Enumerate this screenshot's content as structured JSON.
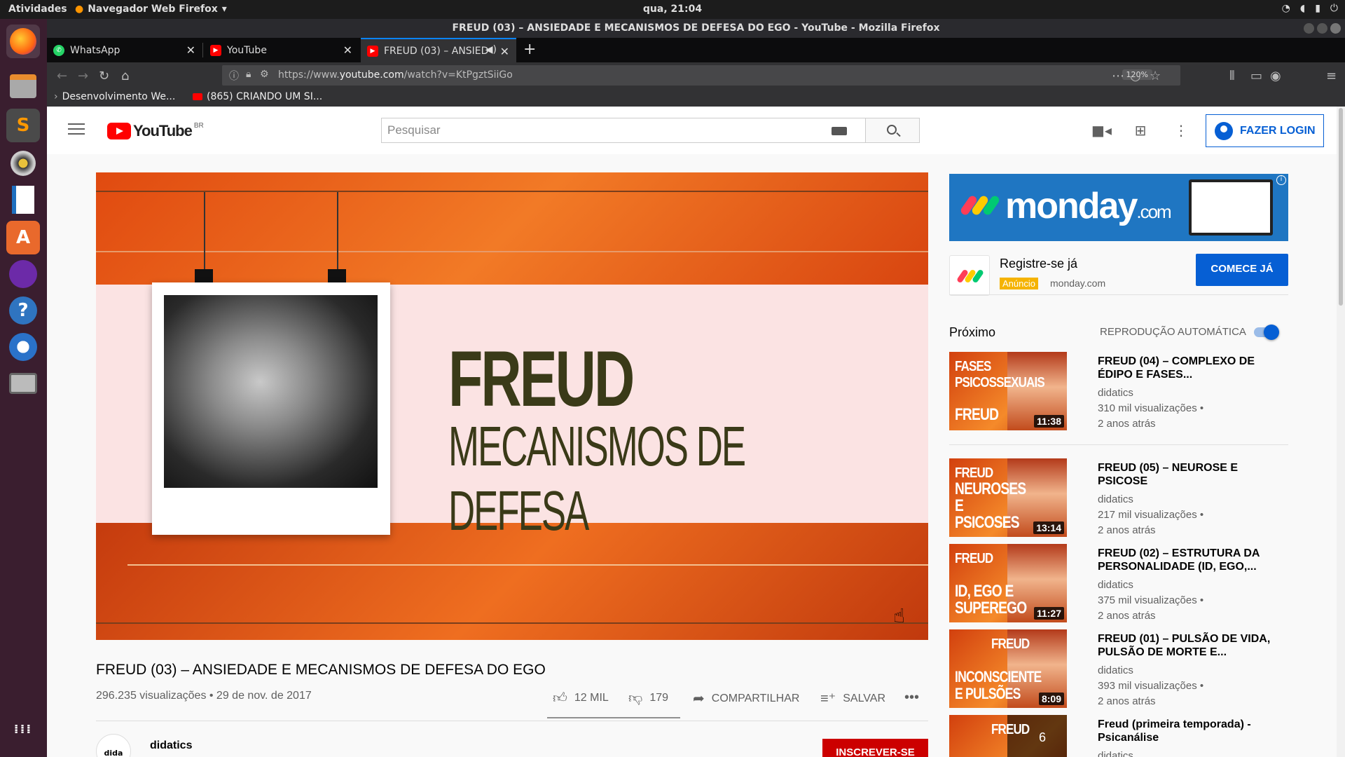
{
  "system": {
    "activities": "Atividades",
    "app_menu": "Navegador Web Firefox",
    "clock": "qua, 21:04"
  },
  "window": {
    "title": "FREUD (03) – ANSIEDADE E MECANISMOS DE DEFESA DO EGO - YouTube - Mozilla Firefox"
  },
  "tabs": [
    {
      "label": "WhatsApp",
      "color": "#25d366"
    },
    {
      "label": "YouTube",
      "color": "#ff0000"
    },
    {
      "label": "FREUD (03) – ANSIED",
      "color": "#ff0000"
    }
  ],
  "navbar": {
    "url_prefix": "https://www.",
    "url_domain": "youtube.com",
    "url_path": "/watch?v=KtPgztSiiGo",
    "zoom": "120%"
  },
  "bookmarks": [
    {
      "label": "Desenvolvimento We..."
    },
    {
      "label": "(865) CRIANDO UM SI..."
    }
  ],
  "header": {
    "logo_text": "YouTube",
    "region": "BR",
    "search_placeholder": "Pesquisar",
    "login_label": "FAZER LOGIN"
  },
  "video": {
    "thumb_title": "FREUD",
    "thumb_subtitle": "MECANISMOS DE DEFESA",
    "title": "FREUD (03) – ANSIEDADE E MECANISMOS DE DEFESA DO EGO",
    "meta": "296.235 visualizações • 29 de nov. de 2017",
    "likes": "12 MIL",
    "dislikes": "179",
    "share_label": "COMPARTILHAR",
    "save_label": "SALVAR",
    "channel": "didatics",
    "channel_avatar_text": "dida",
    "subscribe_label": "INSCREVER-SE"
  },
  "ad": {
    "banner_brand": "monday",
    "banner_suffix": ".com",
    "title": "Registre-se já",
    "badge": "Anúncio",
    "domain": "monday.com",
    "cta": "COMECE JÁ",
    "colors": [
      "#ff3d57",
      "#ffcb00",
      "#00ca72"
    ]
  },
  "sidebar": {
    "next_label": "Próximo",
    "autoplay_label": "REPRODUÇÃO AUTOMÁTICA",
    "autoplay_on": true,
    "recommendations": [
      {
        "thumb_top": "FASES PSICOSSEXUAIS",
        "thumb_bottom": "FREUD",
        "duration": "11:38",
        "title": "FREUD (04) – COMPLEXO DE ÉDIPO E FASES...",
        "channel": "didatics",
        "views": "310 mil visualizações •",
        "age": "2 anos atrás"
      },
      {
        "thumb_top": "FREUD",
        "thumb_bottom": "NEUROSES E PSICOSES",
        "duration": "13:14",
        "title": "FREUD (05) – NEUROSE E PSICOSE",
        "channel": "didatics",
        "views": "217 mil visualizações •",
        "age": "2 anos atrás"
      },
      {
        "thumb_top": "FREUD",
        "thumb_bottom": "ID, EGO E SUPEREGO",
        "duration": "11:27",
        "title": "FREUD (02) – ESTRUTURA DA PERSONALIDADE (ID, EGO,...",
        "channel": "didatics",
        "views": "375 mil visualizações •",
        "age": "2 anos atrás"
      },
      {
        "thumb_top": "FREUD",
        "thumb_bottom": "INCONSCIENTE E PULSÕES",
        "duration": "8:09",
        "title": "FREUD (01) – PULSÃO DE VIDA, PULSÃO DE MORTE E...",
        "channel": "didatics",
        "views": "393 mil visualizações •",
        "age": "2 anos atrás"
      },
      {
        "thumb_top": "FREUD",
        "thumb_bottom": "",
        "duration": "6",
        "title": "Freud (primeira temporada) - Psicanálise",
        "channel": "didatics",
        "views": "",
        "age": ""
      }
    ]
  }
}
